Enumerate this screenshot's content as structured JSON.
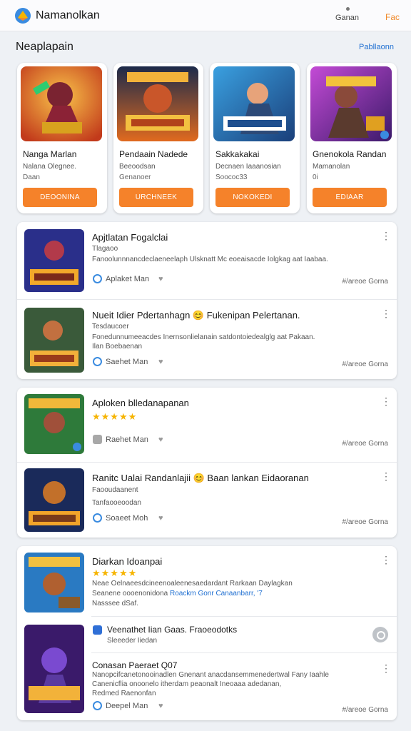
{
  "header": {
    "title": "Namanolkan",
    "right_label": "Ganan",
    "action": "Fac"
  },
  "featured": {
    "title": "Neaplapain",
    "see_all": "Pabllaonn",
    "cards": [
      {
        "name": "Nanga Marlan",
        "sub1": "Nalana Olegnee.",
        "sub2": "Daan",
        "button": "DEOONINA",
        "art": "red"
      },
      {
        "name": "Pendaain Nadede",
        "sub1": "Beeoodsan",
        "sub2": "Genanoer",
        "button": "URCHNEEK",
        "art": "dark"
      },
      {
        "name": "Sakkakakai",
        "sub1": "Decnaen Iaaanosian",
        "sub2": "Soococ33",
        "button": "NOKOKEDI",
        "art": "blue"
      },
      {
        "name": "Gnenokola Randan",
        "sub1": "Mamanolan",
        "sub2": "0i",
        "button": "EDIAAR",
        "art": "purple"
      }
    ]
  },
  "list1": [
    {
      "title": "Apjtlatan Fogalclai",
      "line1": "Tlagaoo",
      "line2": "Fanoolunnnancdeclaeneelaph Ulsknatt Mc eoeaisacde Iolgkag aat Iaabaa.",
      "developer": "Aplaket Man",
      "rating": "#/areoe Gorna"
    },
    {
      "title": "Nueit Idier Pdertanhagn 😊 Fukenipan Pelertanan.",
      "line1": "Tesdaucoer",
      "line2": "Fonedunnumeeacdes Inernsonlielanain satdontoiedealglg aat Pakaan.",
      "line3": "Ilan Boebaenan",
      "developer": "Saehet Man",
      "rating": "#/areoe Gorna"
    }
  ],
  "list2": [
    {
      "title": "Aploken blledanapanan",
      "stars": "★★★★★",
      "developer": "Raehet Man",
      "rating": "#/areoe Gorna"
    },
    {
      "title": "Ranitc Ualai Randanlajii 😊 Baan lankan Eidaoranan",
      "line1": "Faooudaanent",
      "line2": "Tanfaooeoodan",
      "developer": "Soaeet Moh",
      "rating": "#/areoe Gorna"
    }
  ],
  "list3": [
    {
      "title": "Diarkan Idoanpai",
      "stars": "★★★★★",
      "line1": "Neae Oelnaeesdcineenoaleenesaedardant Rarkaan Daylagkan",
      "line2_prefix": "Seanene oooenonidona",
      "line2_link": "Roackm Gonr Canaanbarr, '7",
      "line3": "Nasssee dSaf.",
      "row2_title": "Veenathet Iian Gaas. Fraoeodotks",
      "row2_sub": "Sleeeder Iiedan"
    },
    {
      "title": "Conasan Paeraet Q07",
      "line1": "Nanopcifcanetonooinadlen Gnenant anacdansemmenedertwal Fany Iaahle",
      "line2": "Canenicflia onoonelo itherdam peaonalt Ineoaaa adedanan,",
      "line3": "Redmed Raenonfan",
      "developer": "Deepel Man",
      "rating": "#/areoe Gorna"
    }
  ]
}
